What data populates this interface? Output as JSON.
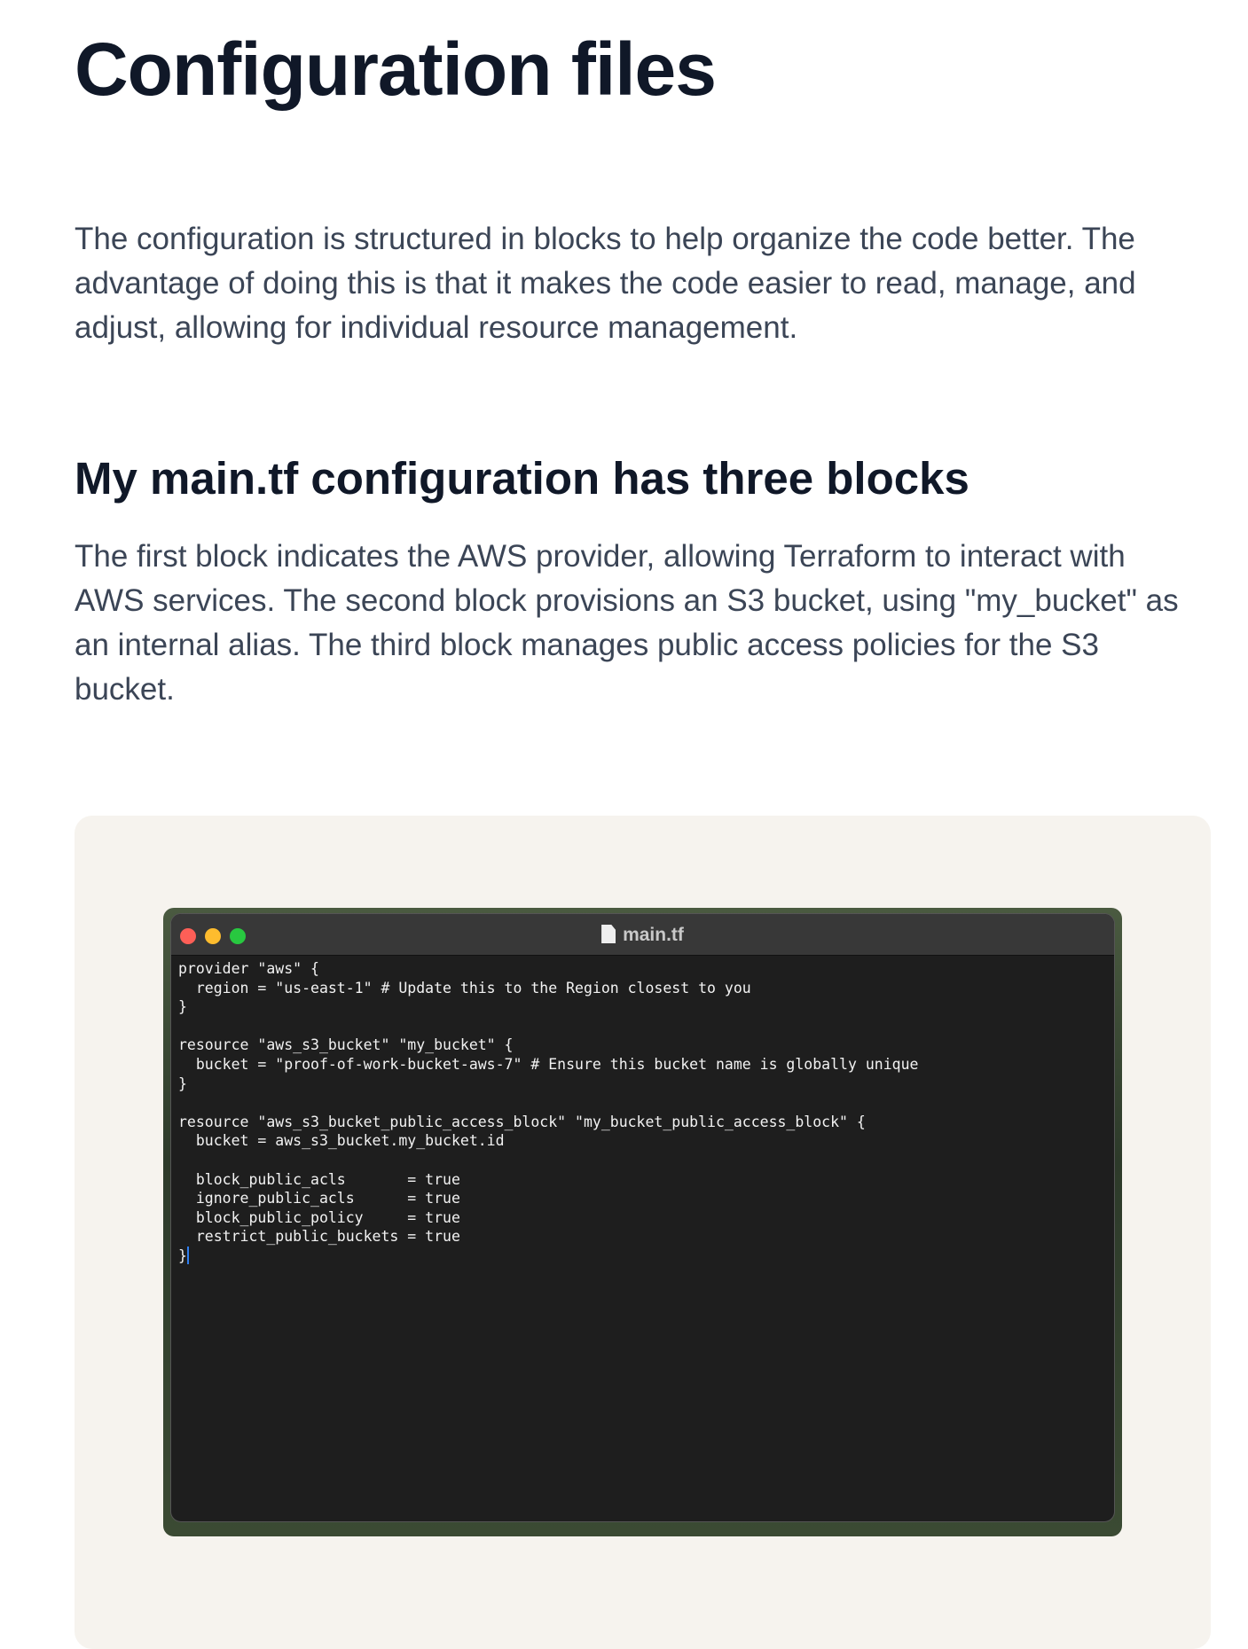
{
  "title": "Configuration files",
  "intro": "The configuration is structured in blocks to help organize the code better. The advantage of doing this is that it makes the code easier to read, manage, and adjust, allowing for individual resource management.",
  "section_heading": "My main.tf configuration has three blocks",
  "section_text": "The first block indicates the AWS provider, allowing Terraform to interact with AWS services. The second block provisions an S3 bucket, using \"my_bucket\" as an internal alias. The third block manages public access policies for the S3 bucket.",
  "editor": {
    "filename": "main.tf",
    "colors": {
      "close": "#fe5f57",
      "minimize": "#febc2e",
      "zoom": "#28c840"
    },
    "code": "provider \"aws\" {\n  region = \"us-east-1\" # Update this to the Region closest to you\n}\n\nresource \"aws_s3_bucket\" \"my_bucket\" {\n  bucket = \"proof-of-work-bucket-aws-7\" # Ensure this bucket name is globally unique\n}\n\nresource \"aws_s3_bucket_public_access_block\" \"my_bucket_public_access_block\" {\n  bucket = aws_s3_bucket.my_bucket.id\n\n  block_public_acls       = true\n  ignore_public_acls      = true\n  block_public_policy     = true\n  restrict_public_buckets = true\n}"
  }
}
